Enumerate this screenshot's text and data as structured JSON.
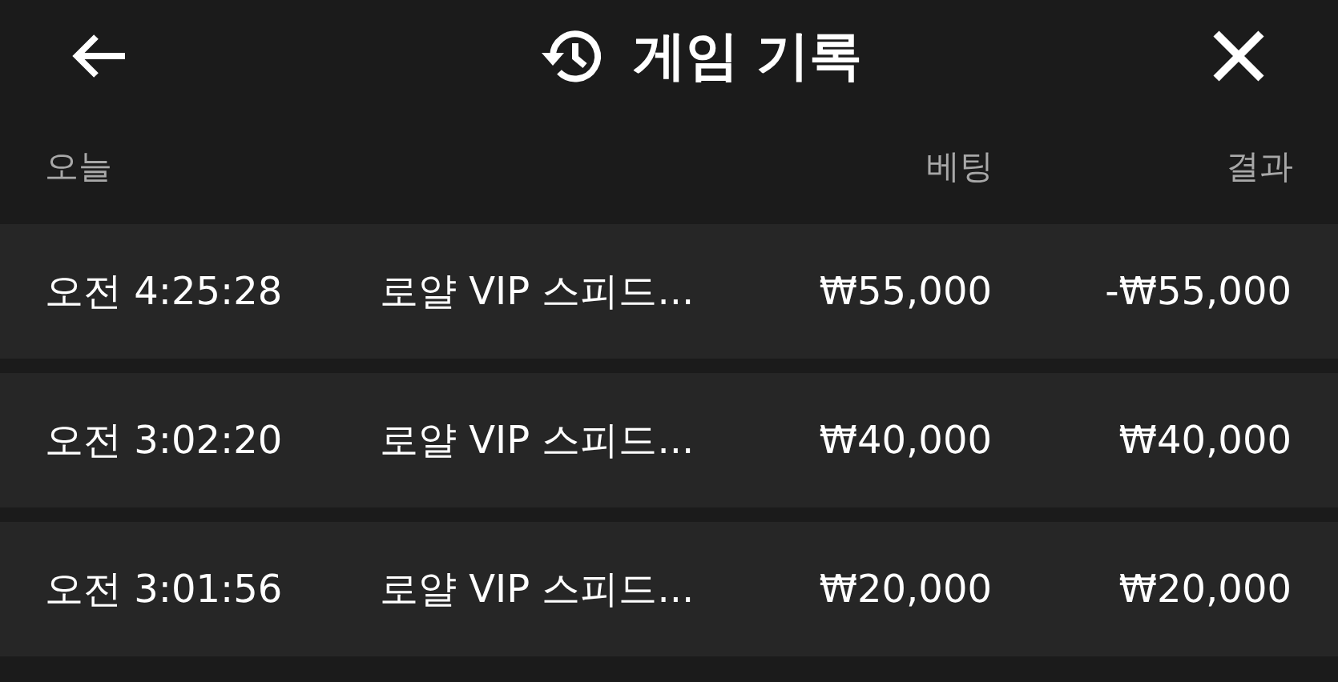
{
  "header": {
    "title": "게임 기록"
  },
  "columns": {
    "date": "오늘",
    "bet": "베팅",
    "result": "결과"
  },
  "rows": [
    {
      "time": "오전 4:25:28",
      "game": "로얄 VIP 스피드...",
      "bet": "₩55,000",
      "result": "-₩55,000"
    },
    {
      "time": "오전 3:02:20",
      "game": "로얄 VIP 스피드...",
      "bet": "₩40,000",
      "result": "₩40,000"
    },
    {
      "time": "오전 3:01:56",
      "game": "로얄 VIP 스피드...",
      "bet": "₩20,000",
      "result": "₩20,000"
    }
  ]
}
